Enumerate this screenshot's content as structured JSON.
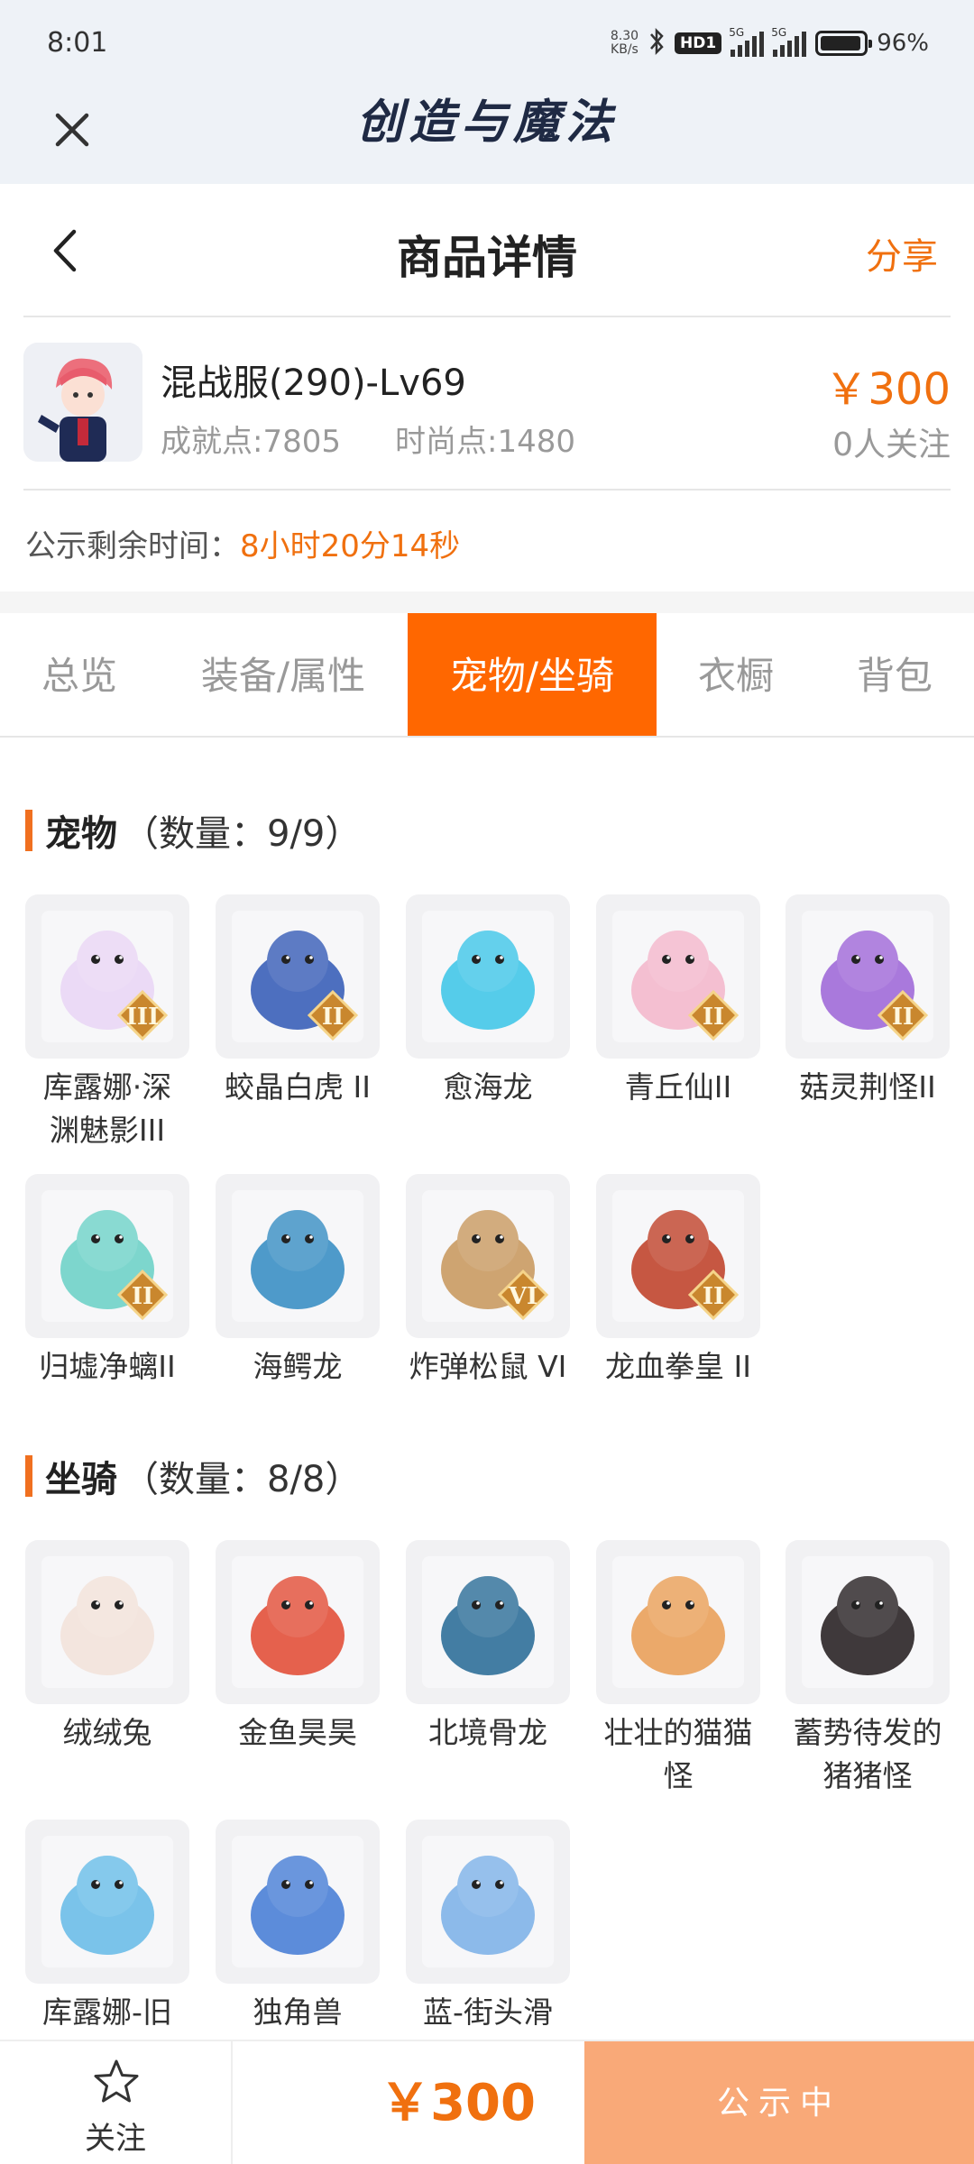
{
  "status_bar": {
    "time": "8:01",
    "net_speed_value": "8.30",
    "net_speed_unit": "KB/s",
    "hd_badge": "HD1",
    "network_1": "5G",
    "network_2": "5G",
    "battery_level": 0.96,
    "battery_text": "96%"
  },
  "app_bar": {
    "title": "创造与魔法"
  },
  "header": {
    "title": "商品详情",
    "share_label": "分享"
  },
  "product": {
    "name": "混战服(290)-Lv69",
    "achievement": "成就点:7805",
    "fashion": "时尚点:1480",
    "price": "￥300",
    "followers": "0人关注"
  },
  "timer": {
    "label": "公示剩余时间：",
    "value": "8小时20分14秒"
  },
  "tabs": [
    {
      "label": "总览",
      "active": false
    },
    {
      "label": "装备/属性",
      "active": false
    },
    {
      "label": "宠物/坐骑",
      "active": true
    },
    {
      "label": "衣橱",
      "active": false
    },
    {
      "label": "背包",
      "active": false
    }
  ],
  "pets": {
    "title": "宠物",
    "count": "（数量：9/9）",
    "items": [
      {
        "line1": "库露娜·深",
        "line2": "渊魅影III",
        "tier": "III",
        "color": "#e9d6f5"
      },
      {
        "line1": "蛟晶白虎 II",
        "line2": "",
        "tier": "II",
        "color": "#3a5fb8"
      },
      {
        "line1": "愈海龙",
        "line2": "",
        "tier": "",
        "color": "#43c6e8"
      },
      {
        "line1": "青丘仙II",
        "line2": "",
        "tier": "II",
        "color": "#f3b8cc"
      },
      {
        "line1": "菇灵荆怪II",
        "line2": "",
        "tier": "II",
        "color": "#a06ad8"
      },
      {
        "line1": "归墟净螭II",
        "line2": "",
        "tier": "II",
        "color": "#6fd2c8"
      },
      {
        "line1": "海鳄龙",
        "line2": "",
        "tier": "",
        "color": "#3b8fc4"
      },
      {
        "line1": "炸弹松鼠 VI",
        "line2": "",
        "tier": "VI",
        "color": "#c99a62"
      },
      {
        "line1": "龙血拳皇 II",
        "line2": "",
        "tier": "II",
        "color": "#c0452e"
      }
    ]
  },
  "mounts": {
    "title": "坐骑",
    "count": "（数量：8/8）",
    "items": [
      {
        "line1": "绒绒兔",
        "line2": "",
        "color": "#f2e2da"
      },
      {
        "line1": "金鱼昊昊",
        "line2": "",
        "color": "#e2503a"
      },
      {
        "line1": "北境骨龙",
        "line2": "",
        "color": "#2f6f99"
      },
      {
        "line1": "壮壮的猫猫",
        "line2": "怪",
        "color": "#e9a05a"
      },
      {
        "line1": "蓄势待发的",
        "line2": "猪猪怪",
        "color": "#2a2426"
      },
      {
        "line1": "库露娜-旧",
        "line2": "",
        "color": "#6bbde8"
      },
      {
        "line1": "独角兽",
        "line2": "",
        "color": "#4a7fd6"
      },
      {
        "line1": "蓝-街头滑",
        "line2": "",
        "color": "#7fb3e8"
      }
    ]
  },
  "bottom_bar": {
    "follow_label": "关注",
    "price": "￥300",
    "status_label": "公示中"
  },
  "colors": {
    "accent": "#f0700f",
    "tab_active": "#ff6700",
    "status_button": "#f9a978"
  }
}
